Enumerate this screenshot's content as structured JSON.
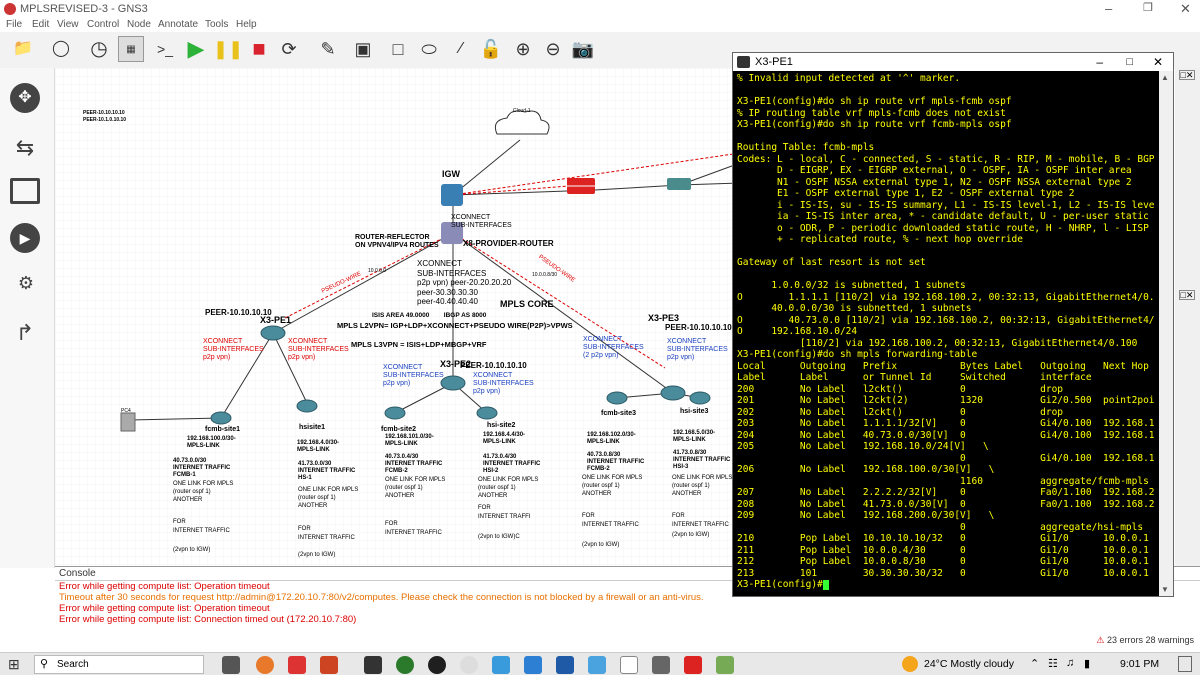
{
  "window": {
    "title": "MPLSREVISED-3 - GNS3"
  },
  "menu": [
    "File",
    "Edit",
    "View",
    "Control",
    "Node",
    "Annotate",
    "Tools",
    "Help"
  ],
  "terminal": {
    "title": "X3-PE1",
    "lines": [
      "% Invalid input detected at '^' marker.",
      "",
      "X3-PE1(config)#do sh ip route vrf mpls-fcmb ospf",
      "% IP routing table vrf mpls-fcmb does not exist",
      "X3-PE1(config)#do sh ip route vrf fcmb-mpls ospf",
      "",
      "Routing Table: fcmb-mpls",
      "Codes: L - local, C - connected, S - static, R - RIP, M - mobile, B - BGP",
      "       D - EIGRP, EX - EIGRP external, O - OSPF, IA - OSPF inter area",
      "       N1 - OSPF NSSA external type 1, N2 - OSPF NSSA external type 2",
      "       E1 - OSPF external type 1, E2 - OSPF external type 2",
      "       i - IS-IS, su - IS-IS summary, L1 - IS-IS level-1, L2 - IS-IS level-2",
      "       ia - IS-IS inter area, * - candidate default, U - per-user static route",
      "       o - ODR, P - periodic downloaded static route, H - NHRP, l - LISP",
      "       + - replicated route, % - next hop override",
      "",
      "Gateway of last resort is not set",
      "",
      "      1.0.0.0/32 is subnetted, 1 subnets",
      "O        1.1.1.1 [110/2] via 192.168.100.2, 00:32:13, GigabitEthernet4/0.100",
      "      40.0.0.0/30 is subnetted, 1 subnets",
      "O        40.73.0.0 [110/2] via 192.168.100.2, 00:32:13, GigabitEthernet4/0.100",
      "O     192.168.10.0/24",
      "           [110/2] via 192.168.100.2, 00:32:13, GigabitEthernet4/0.100",
      "X3-PE1(config)#do sh mpls forwarding-table",
      "Local      Outgoing   Prefix           Bytes Label   Outgoing   Next Hop",
      "Label      Label      or Tunnel Id     Switched      interface",
      "200        No Label   l2ckt()          0             drop",
      "201        No Label   l2ckt(2)         1320          Gi2/0.500  point2point",
      "202        No Label   l2ckt()          0             drop",
      "203        No Label   1.1.1.1/32[V]    0             Gi4/0.100  192.168.100.2",
      "204        No Label   40.73.0.0/30[V]  0             Gi4/0.100  192.168.100.2",
      "205        No Label   192.168.10.0/24[V]   \\",
      "                                       0             Gi4/0.100  192.168.100.2",
      "206        No Label   192.168.100.0/30[V]   \\",
      "                                       1160          aggregate/fcmb-mpls",
      "207        No Label   2.2.2.2/32[V]    0             Fa0/1.100  192.168.200.2",
      "208        No Label   41.73.0.0/30[V]  0             Fa0/1.100  192.168.200.2",
      "209        No Label   192.168.200.0/30[V]   \\",
      "                                       0             aggregate/hsi-mpls",
      "210        Pop Label  10.10.10.10/32   0             Gi1/0      10.0.0.1",
      "211        Pop Label  10.0.0.4/30      0             Gi1/0      10.0.0.1",
      "212        Pop Label  10.0.0.8/30      0             Gi1/0      10.0.0.1",
      "213        101        30.30.30.30/32   0             Gi1/0      10.0.0.1",
      "X3-PE1(config)#"
    ]
  },
  "console": {
    "header": "Console",
    "lines": [
      {
        "text": "Error while getting compute list: Operation timeout",
        "color": "red"
      },
      {
        "text": "Timeout after 30 seconds for request http://admin@172.20.10.7:80/v2/computes. Please check the connection is not blocked by a firewall or an anti-virus.",
        "color": "orange"
      },
      {
        "text": "Error while getting compute list: Operation timeout",
        "color": "red"
      },
      {
        "text": "Error while getting compute list: Connection timed out (172.20.10.7:80)",
        "color": "red"
      }
    ]
  },
  "status": {
    "errors": "23 errors 28 warnings"
  },
  "taskbar": {
    "search": "Search",
    "weather": "24°C  Mostly cloudy",
    "time": "9:01 PM"
  },
  "diagram": {
    "labels": {
      "igw": "IGW",
      "xconnect_top": "XCONNECT\nSUB-INTERFACES",
      "rr": "ROUTER-REFLECTOR\nON VPNV4/IPV4 ROUTES",
      "x8": "X8-PROVIDER-ROUTER",
      "xconnect_center": "XCONNECT\nSUB-INTERFACES\np2p vpn) peer-20.20.20.20\npeer-30.30.30.30\npeer-40.40.40.40",
      "mpls_core": "MPLS CORE",
      "pe1_name": "X3-PE1",
      "peer_left": "PEER-10.10.10.10",
      "isis": "ISIS AREA 49.0000        IBGP AS 8000",
      "l2vpn": "MPLS L2VPN= IGP+LDP+XCONNECT+PSEUDO WIRE(P2P)>VPWS",
      "l3vpn": "MPLS L3VPN = ISIS+LDP+MBGP+VRF",
      "pe3_name": "X3-PE3",
      "peer_right": "PEER-10.10.10.10",
      "pe2_name": "X3-PE2",
      "peer_mid": "PEER-10.10.10.10",
      "xconnect_l1": "XCONNECT\nSUB-INTERFACES\np2p vpn)",
      "xconnect_l2": "XCONNECT\nSUB-INTERFACES\np2p vpn)",
      "xconnect_m1": "XCONNECT\nSUB-INTERFACES\np2p vpn)",
      "xconnect_m2": "XCONNECT\nSUB-INTERFACES\np2p vpn)",
      "xconnect_r1": "XCONNECT\nSUB-INTERFACES\n(2 p2p vpn)",
      "xconnect_r2": "XCONNECT\nSUB-INTERFACES\np2p vpn)",
      "pseudo1": "PSEUDO-WIRE",
      "pseudo2": "PSEUDO-WIRE",
      "fcmb1": "fcmb-site1",
      "hsi1": "hsisite1",
      "fcmb2": "fcmb-site2",
      "hsi2": "hsi-site2",
      "fcmb3": "fcmb-site3",
      "hsi3": "hsi-site3",
      "fcmb1_net": "192.168.100.0/30-\nMPLS-LINK",
      "hsi1_net": "192.168.4.0/30-\nMPLS-LINK",
      "fcmb2_net": "192.168.101.0/30-\nMPLS-LINK",
      "hsi2_net": "192.168.4.4/30-\nMPLS-LINK",
      "fcmb3_net": "192.168.102.0/30-\nMPLS-LINK",
      "hsi3_net": "192.168.5.0/30-\nMPLS-LINK",
      "fcmb1_it": "40.73.0.0/30\nINTERNET TRAFFIC\nFCMB-1",
      "hsi1_it": "41.73.0.0/30\nINTERNET TRAFFIC\nHS-1",
      "fcmb2_it": "40.73.0.4/30\nINTERNET TRAFFIC\nFCMB-2",
      "hsi2_it": "41.73.0.4/30\nINTERNET TRAFFIC\nHSI-2",
      "fcmb3_it": "40.73.0.8/30\nINTERNET TRAFFIC\nFCMB-2",
      "hsi3_it": "41.73.0.8/30\nINTERNET TRAFFIC\nHSI-3",
      "ospf1": "ONE LINK FOR MPLS\n(router ospf 1)\nANOTHER",
      "ospf2": "ONE LINK FOR MPLS\n(router ospf 1)\nANOTHER",
      "ospf3": "ONE LINK FOR MPLS\n(router ospf 1)\nANOTHER",
      "ospf4": "ONE LINK FOR MPLS\n(router ospf 1)\nANOTHER",
      "ospf5": "ONE LINK FOR MPLS\n(router ospf 1)\nANOTHER",
      "ospf6": "ONE LINK FOR MPLS\n(router ospf 1)\nANOTHER",
      "for1": "FOR\nINTERNET TRAFFIC",
      "for2": "FOR\nINTERNET TRAFFIC",
      "for3": "FOR\nINTERNET TRAFFIC",
      "for4": "FOR\nINTERNET TRAFFI",
      "for5": "FOR\nINTERNET TRAFFIC",
      "for6": "FOR\nINTERNET TRAFFIC",
      "vpn1": "(2vpn to IGW)",
      "vpn2": "(2vpn to IGW)",
      "vpn3": "(2vpn to IGW)C",
      "vpn4": "(2vpn to IGW)",
      "vpn5": "(2vpn to IGW)",
      "peer_small1": "PEER-10.10.10.10",
      "peer_small2": "PEER-10.1.0.10.10",
      "cloud": "Cloud-1",
      "pc": "PC4",
      "ip_a": "10.0.0.0",
      "ip_b": "10.0.0.8/30"
    }
  }
}
